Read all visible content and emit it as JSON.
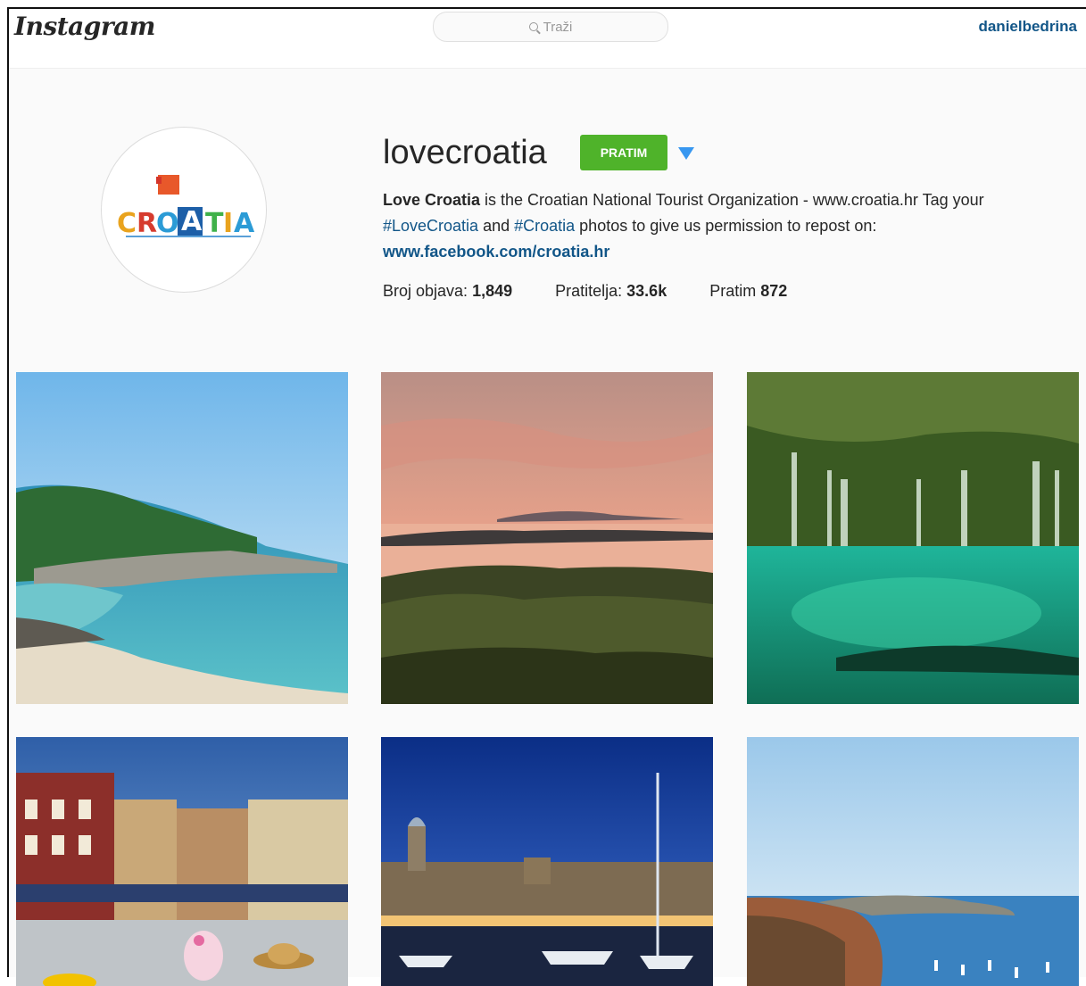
{
  "header": {
    "logo": "Instagram",
    "search_placeholder": "Traži",
    "current_user": "danielbedrina"
  },
  "profile": {
    "username": "lovecroatia",
    "follow_button": "PRATIM",
    "avatar_text": "CROATIA",
    "bio": {
      "name": "Love Croatia",
      "text1": " is the Croatian National Tourist Organization - www.croatia.hr Tag your ",
      "hashtag1": "#LoveCroatia",
      "text2": " and ",
      "hashtag2": "#Croatia",
      "text3": " photos to give us permission to repost on: ",
      "link": "www.facebook.com/croatia.hr"
    },
    "stats": [
      {
        "label": "Broj objava: ",
        "value": "1,849"
      },
      {
        "label": "Pratitelja: ",
        "value": "33.6k"
      },
      {
        "label": "Pratim ",
        "value": "872"
      }
    ]
  },
  "colors": {
    "follow_green": "#4fb32a",
    "link_blue": "#125688",
    "caret_blue": "#3897f0"
  }
}
